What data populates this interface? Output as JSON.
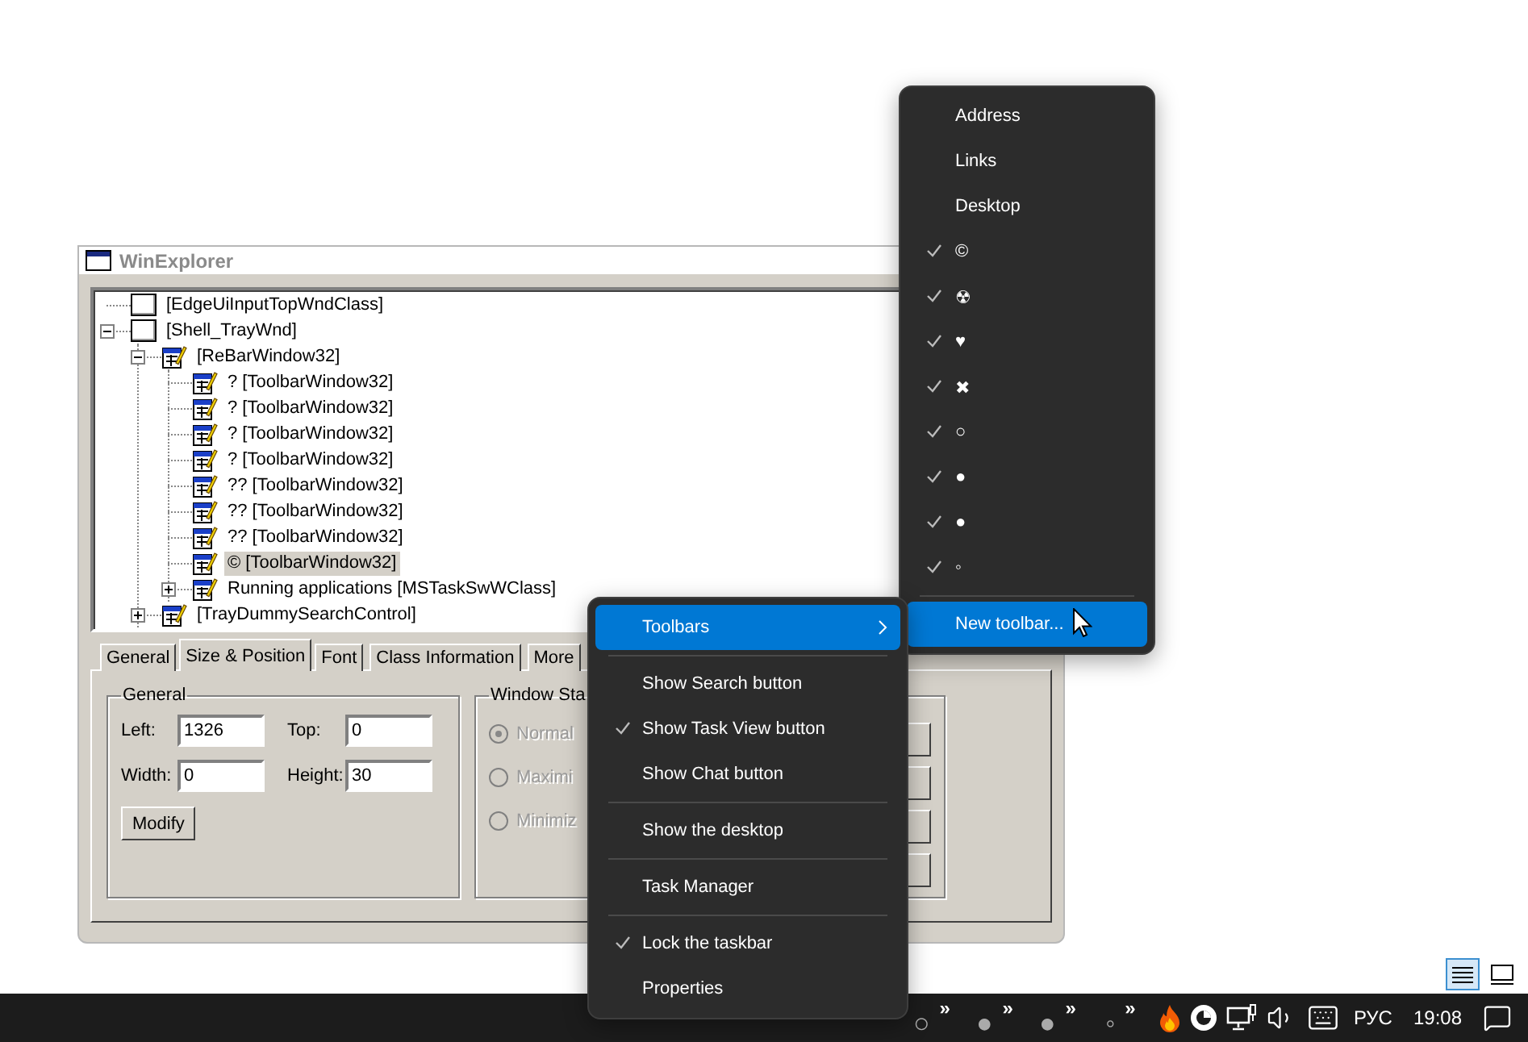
{
  "window": {
    "title": "WinExplorer",
    "active": false,
    "tree": [
      {
        "label": "[EdgeUiInputTopWndClass]",
        "kind": "blank",
        "selected": false
      },
      {
        "label": "[Shell_TrayWnd]",
        "kind": "blank",
        "selected": false,
        "expanded": true,
        "children": [
          {
            "label": "[ReBarWindow32]",
            "kind": "window",
            "selected": false,
            "expanded": true,
            "children": [
              {
                "label": "? [ToolbarWindow32]",
                "kind": "window",
                "selected": false
              },
              {
                "label": "? [ToolbarWindow32]",
                "kind": "window",
                "selected": false
              },
              {
                "label": "? [ToolbarWindow32]",
                "kind": "window",
                "selected": false
              },
              {
                "label": "? [ToolbarWindow32]",
                "kind": "window",
                "selected": false
              },
              {
                "label": "?? [ToolbarWindow32]",
                "kind": "window",
                "selected": false
              },
              {
                "label": "?? [ToolbarWindow32]",
                "kind": "window",
                "selected": false
              },
              {
                "label": "?? [ToolbarWindow32]",
                "kind": "window",
                "selected": false
              },
              {
                "label": "© [ToolbarWindow32]",
                "kind": "window",
                "selected": true
              },
              {
                "label": "Running applications [MSTaskSwWClass]",
                "kind": "window",
                "selected": false,
                "expanded": false
              }
            ]
          },
          {
            "label": "[TrayDummySearchControl]",
            "kind": "window",
            "selected": false,
            "expanded": false
          }
        ]
      }
    ],
    "tabs": [
      {
        "label": "General",
        "selected": false
      },
      {
        "label": "Size & Position",
        "selected": true
      },
      {
        "label": "Font",
        "selected": false
      },
      {
        "label": "Class Information",
        "selected": false
      },
      {
        "label": "More",
        "selected": false
      }
    ],
    "general_group": {
      "title": "General",
      "fields": [
        {
          "label": "Left:",
          "value": "1326"
        },
        {
          "label": "Top:",
          "value": "0"
        },
        {
          "label": "Width:",
          "value": "0"
        },
        {
          "label": "Height:",
          "value": "30"
        }
      ],
      "button": "Modify"
    },
    "window_state_group": {
      "title": "Window Sta",
      "options": [
        {
          "label": "Normal",
          "selected": true,
          "disabled": true
        },
        {
          "label": "Maximi",
          "selected": false,
          "disabled": true
        },
        {
          "label": "Minimiz",
          "selected": false,
          "disabled": true
        }
      ]
    }
  },
  "context_menu": {
    "items": [
      {
        "kind": "submenu",
        "label": "Toolbars",
        "checked": false,
        "selected": true
      },
      {
        "kind": "separator"
      },
      {
        "kind": "item",
        "label": "Show Search button",
        "checked": false,
        "selected": false
      },
      {
        "kind": "item",
        "label": "Show Task View button",
        "checked": true,
        "selected": false
      },
      {
        "kind": "item",
        "label": "Show Chat button",
        "checked": false,
        "selected": false
      },
      {
        "kind": "separator"
      },
      {
        "kind": "item",
        "label": "Show the desktop",
        "checked": false,
        "selected": false
      },
      {
        "kind": "separator"
      },
      {
        "kind": "item",
        "label": "Task Manager",
        "checked": false,
        "selected": false
      },
      {
        "kind": "separator"
      },
      {
        "kind": "item",
        "label": "Lock the taskbar",
        "checked": true,
        "selected": false
      },
      {
        "kind": "item",
        "label": "Properties",
        "checked": false,
        "selected": false
      }
    ]
  },
  "toolbars_submenu": {
    "items": [
      {
        "kind": "item",
        "label": "Address",
        "checked": false,
        "selected": false
      },
      {
        "kind": "item",
        "label": "Links",
        "checked": false,
        "selected": false
      },
      {
        "kind": "item",
        "label": "Desktop",
        "checked": false,
        "selected": false
      },
      {
        "kind": "item",
        "label": "©",
        "checked": true,
        "selected": false
      },
      {
        "kind": "item",
        "label": "☢",
        "checked": true,
        "selected": false
      },
      {
        "kind": "item",
        "label": "♥",
        "checked": true,
        "selected": false
      },
      {
        "kind": "item",
        "label": "✖",
        "checked": true,
        "selected": false
      },
      {
        "kind": "item",
        "label": "○",
        "checked": true,
        "selected": false
      },
      {
        "kind": "item",
        "label": "●",
        "checked": true,
        "selected": false
      },
      {
        "kind": "item",
        "label": "●",
        "checked": true,
        "selected": false
      },
      {
        "kind": "item",
        "label": "◦",
        "checked": true,
        "selected": false
      },
      {
        "kind": "separator"
      },
      {
        "kind": "item",
        "label": "New toolbar...",
        "checked": false,
        "selected": true
      }
    ]
  },
  "taskbar": {
    "toolbars": [
      {
        "label": "○",
        "chevron": "»"
      },
      {
        "label": "●",
        "chevron": "»"
      },
      {
        "label": "●",
        "chevron": "»"
      },
      {
        "label": "◦",
        "chevron": "»"
      }
    ],
    "language": "РУС",
    "time": "19:08"
  }
}
